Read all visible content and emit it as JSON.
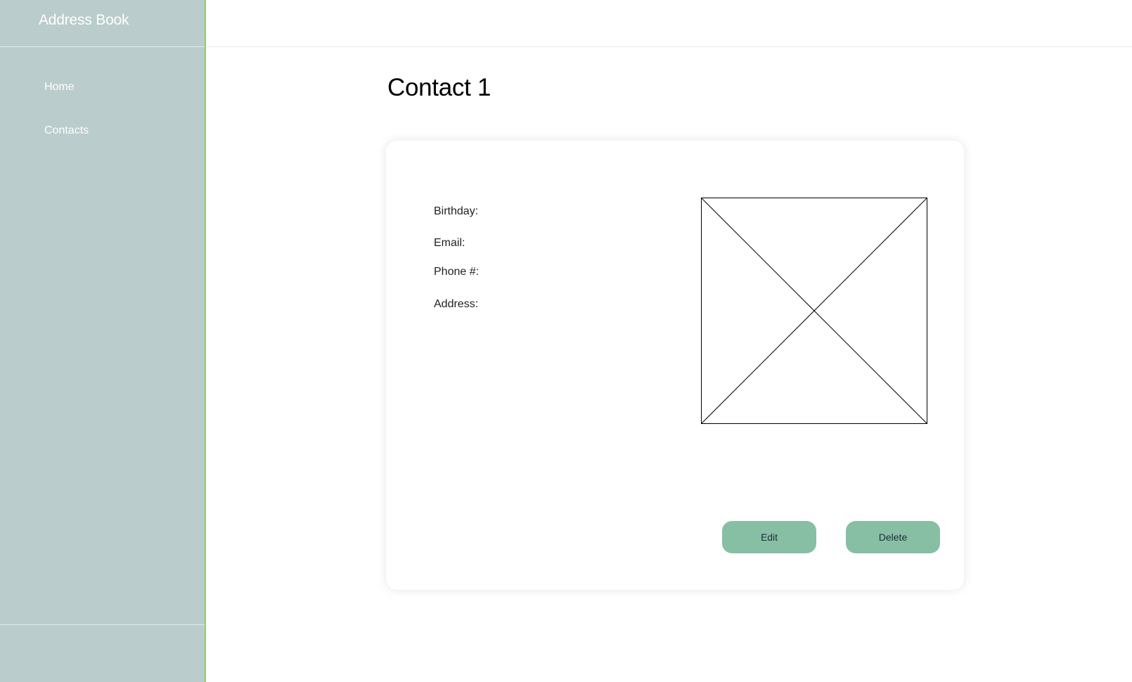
{
  "sidebar": {
    "app_title": "Address Book",
    "nav": [
      {
        "label": "Home"
      },
      {
        "label": "Contacts"
      }
    ]
  },
  "main": {
    "page_title": "Contact 1",
    "card": {
      "fields": {
        "birthday_label": "Birthday:",
        "email_label": "Email:",
        "phone_label": "Phone #:",
        "address_label": "Address:"
      },
      "photo_icon": "image-placeholder-icon",
      "buttons": {
        "edit_label": "Edit",
        "delete_label": "Delete"
      }
    }
  },
  "colors": {
    "sidebar_bg": "#bacccb",
    "sidebar_border": "#8fce6b",
    "button_bg": "#87bfa5",
    "button_text": "#1e2c3a"
  }
}
